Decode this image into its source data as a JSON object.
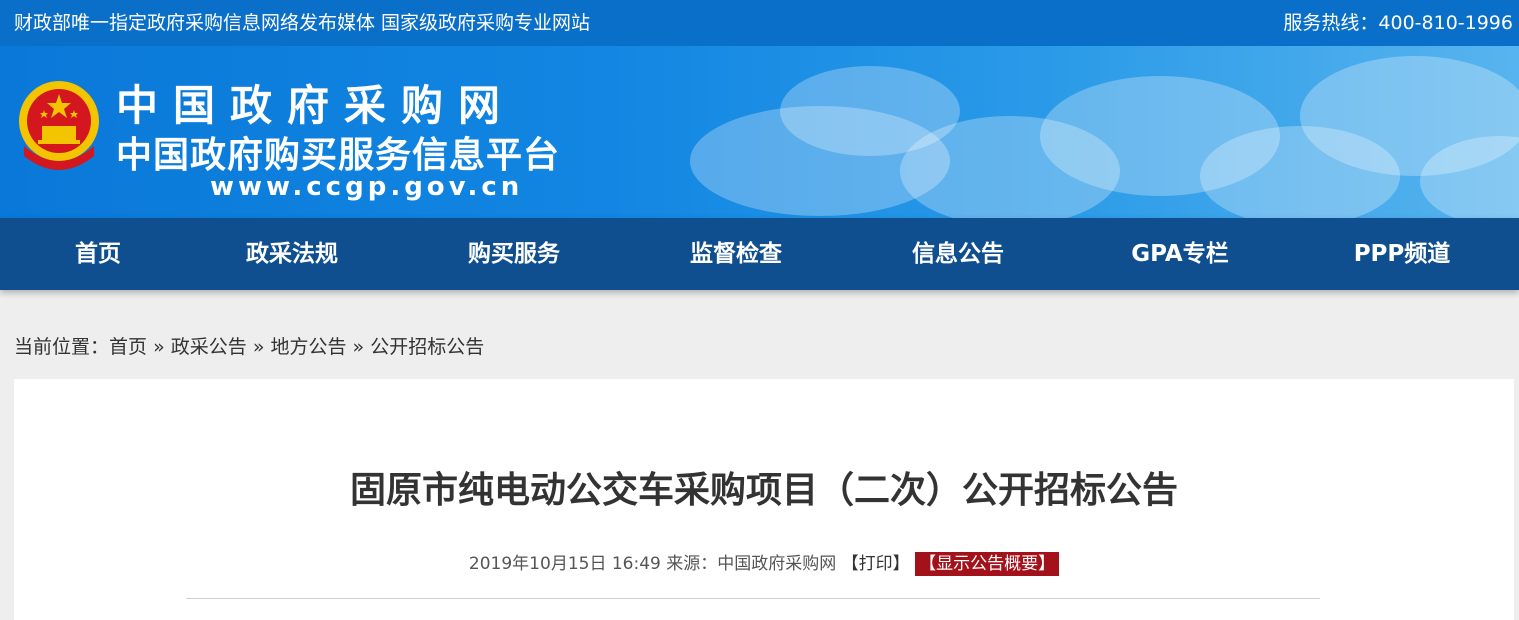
{
  "topbar": {
    "slogan": "财政部唯一指定政府采购信息网络发布媒体 国家级政府采购专业网站",
    "hotline": "服务热线：400-810-1996"
  },
  "banner": {
    "title": "中国政府采购网",
    "subtitle": "中国政府购买服务信息平台",
    "url": "www.ccgp.gov.cn",
    "emblem_icon": "national-emblem-icon"
  },
  "nav": {
    "items": [
      {
        "label": "首页"
      },
      {
        "label": "政采法规"
      },
      {
        "label": "购买服务"
      },
      {
        "label": "监督检查"
      },
      {
        "label": "信息公告"
      },
      {
        "label": "GPA专栏"
      },
      {
        "label": "PPP频道"
      }
    ]
  },
  "breadcrumb": {
    "prefix": "当前位置：",
    "items": [
      "首页",
      "政采公告",
      "地方公告",
      "公开招标公告"
    ],
    "separator": "»"
  },
  "article": {
    "title": "固原市纯电动公交车采购项目（二次）公开招标公告",
    "date": "2019年10月15日 16:49",
    "source_label": "来源：",
    "source": "中国政府采购网",
    "print": "【打印】",
    "summary": "【显示公告概要】"
  },
  "colors": {
    "topbar": "#0a6fc9",
    "nav": "#0f4e8f",
    "summary_badge": "#a3121a"
  }
}
